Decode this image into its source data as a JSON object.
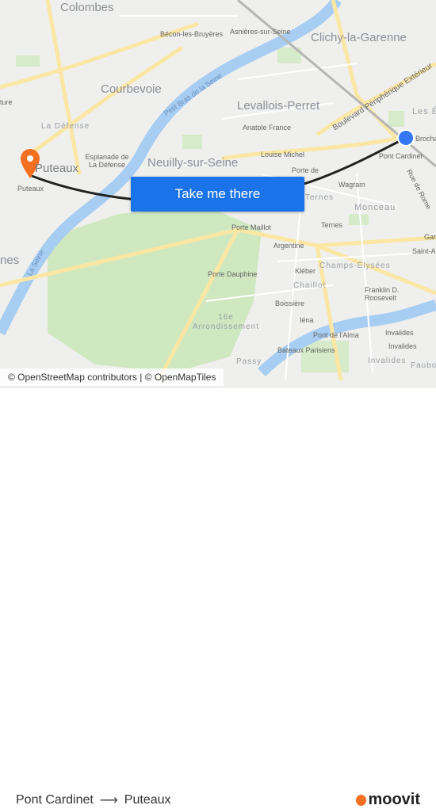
{
  "map": {
    "labels": {
      "colombes": "Colombes",
      "becon": "Bécon-les-Bruyères",
      "asnieres": "Asnières-sur-Seine",
      "clichy": "Clichy-la-Garenne",
      "courbevoie": "Courbevoie",
      "levallois": "Levallois-Perret",
      "petit_bras": "Petit Bras de la Seine",
      "bd_peripherique": "Boulevard Périphérique Extérieur",
      "les_ep": "Les Ép",
      "brochant": "Brochant",
      "anatole": "Anatole France",
      "louise": "Louise Michel",
      "la_defense": "La Défense",
      "esplanade": "Esplanade de La Défense",
      "neuilly": "Neuilly-sur-Seine",
      "pont_cardinet": "Pont Cardinet",
      "rue_de_rome": "Rue de Rome",
      "porte_de": "Porte de",
      "wagram": "Wagram",
      "ternes_d": "Ternes",
      "monceau": "Monceau",
      "ternes": "Ternes",
      "puteaux_map": "Puteaux",
      "puteaux_small": "Puteaux",
      "porte_maillot": "Porte Maillot",
      "argentine": "Argentine",
      "champs": "Champs-Élysées",
      "la_seine": "La Seine",
      "kleber": "Kléber",
      "porte_dauphine": "Porte Dauphine",
      "chaillot": "Chaillot",
      "franklin": "Franklin D. Roosevelt",
      "boissiere": "Boissière",
      "arr16": "16e Arrondissement",
      "iena": "Iéna",
      "pont_alma": "Pont de l'Alma",
      "invalides1": "Invalides",
      "invalides2": "Invalides",
      "invalides_d": "Invalides",
      "bateaux": "Bateaux Parisiens",
      "passy": "Passy",
      "nes": "nes",
      "ture": "ture",
      "saint_a": "Saint-A",
      "gar": "Gar",
      "faubo": "Faubo"
    },
    "origin_color": "#3478f6",
    "destination_color": "#f36f21",
    "route_color": "#222222"
  },
  "cta": {
    "label": "Take me there"
  },
  "attribution": "© OpenStreetMap contributors | © OpenMapTiles",
  "footer": {
    "from": "Pont Cardinet",
    "arrow": "⟶",
    "to": "Puteaux",
    "brand": "moovit"
  }
}
